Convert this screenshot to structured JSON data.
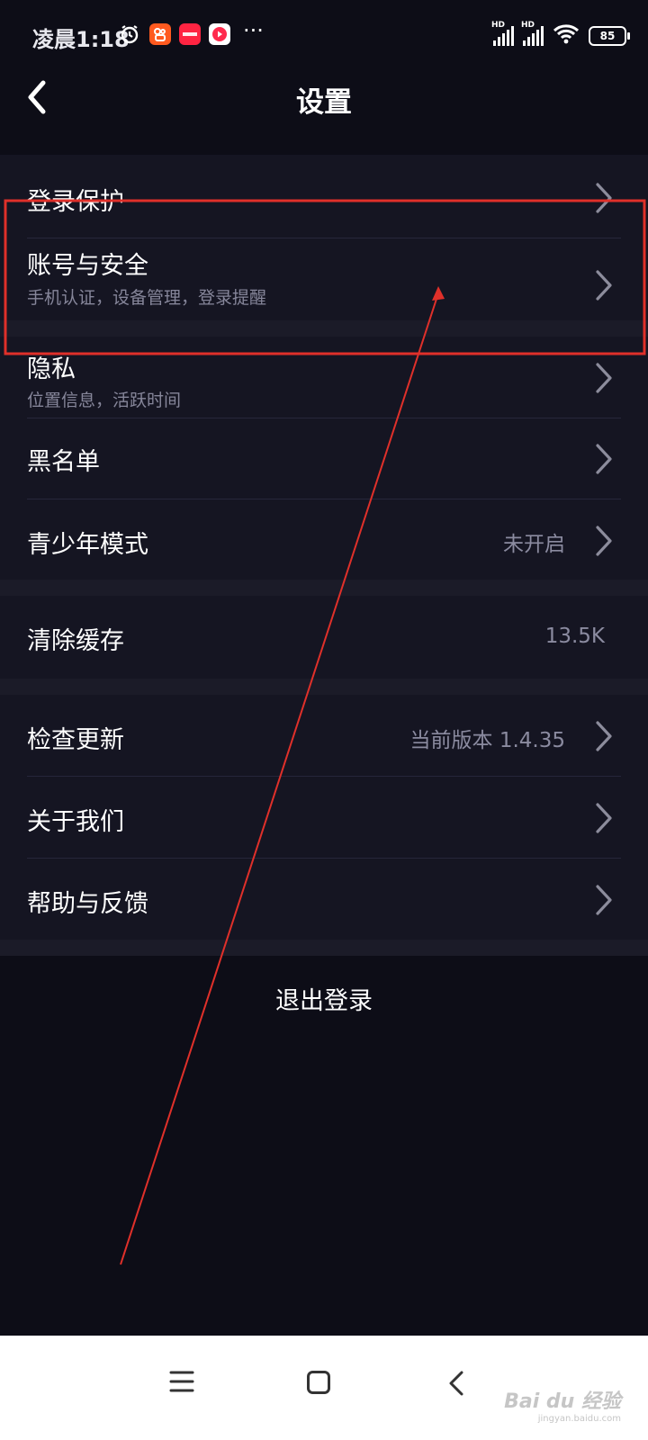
{
  "status_bar": {
    "time": "凌晨1:18",
    "network_tag": "HD",
    "battery": "85",
    "more": "···",
    "app_icons": [
      "alarm-icon",
      "kuaishou-icon",
      "xiaohongshu-icon",
      "video-app-icon"
    ]
  },
  "header": {
    "title": "设置"
  },
  "settings": {
    "login_protection": {
      "label": "登录保护"
    },
    "account_security": {
      "label": "账号与安全",
      "sub": "手机认证，设备管理，登录提醒"
    },
    "privacy": {
      "label": "隐私",
      "sub": "位置信息，活跃时间"
    },
    "blacklist": {
      "label": "黑名单"
    },
    "teen_mode": {
      "label": "青少年模式",
      "value": "未开启"
    },
    "clear_cache": {
      "label": "清除缓存",
      "value": "13.5K"
    },
    "check_update": {
      "label": "检查更新",
      "value": "当前版本 1.4.35"
    },
    "about_us": {
      "label": "关于我们"
    },
    "help_feedback": {
      "label": "帮助与反馈"
    }
  },
  "logout": {
    "label": "退出登录"
  },
  "watermark": {
    "text": "Bai du 经验",
    "sub": "jingyan.baidu.com"
  },
  "colors": {
    "background": "#0d0d17",
    "row_background": "#151522",
    "annotation_red": "#e0302a"
  }
}
